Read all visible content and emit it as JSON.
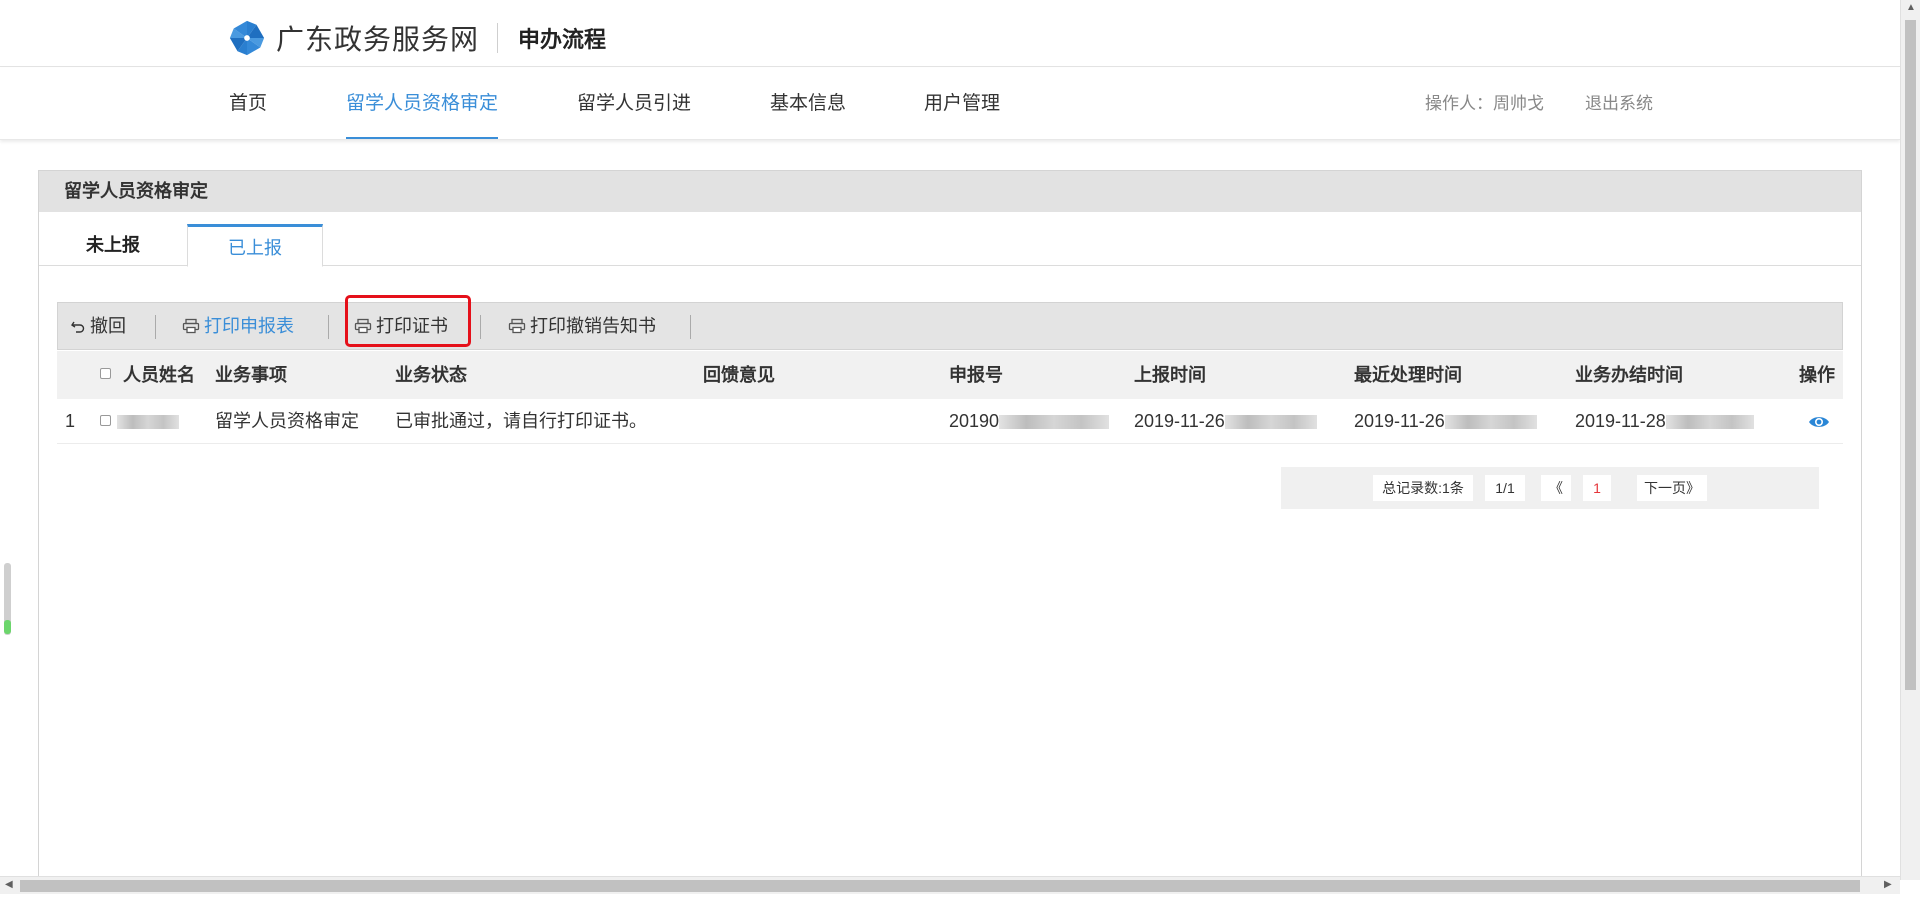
{
  "header": {
    "site_title": "广东政务服务网",
    "subtitle": "申办流程"
  },
  "nav": {
    "items": [
      {
        "label": "首页"
      },
      {
        "label": "留学人员资格审定"
      },
      {
        "label": "留学人员引进"
      },
      {
        "label": "基本信息"
      },
      {
        "label": "用户管理"
      }
    ],
    "active_index": 1,
    "operator": "操作人：周帅戈",
    "logout": "退出系统"
  },
  "panel": {
    "title": "留学人员资格审定",
    "tabs": [
      {
        "label": "未上报"
      },
      {
        "label": "已上报"
      }
    ],
    "active_tab": 1
  },
  "toolbar": {
    "withdraw": "撤回",
    "print_form": "打印申报表",
    "print_certificate": "打印证书",
    "print_cancel_notice": "打印撤销告知书"
  },
  "table": {
    "headers": {
      "name": "人员姓名",
      "item": "业务事项",
      "status": "业务状态",
      "feedback": "回馈意见",
      "report_no": "申报号",
      "report_time": "上报时间",
      "last_process_time": "最近处理时间",
      "finish_time": "业务办结时间",
      "action": "操作"
    },
    "rows": [
      {
        "index": "1",
        "item": "留学人员资格审定",
        "status": "已审批通过，请自行打印证书。",
        "feedback": "",
        "report_no": "20190",
        "report_time": "2019-11-26",
        "last_process_time": "2019-11-26",
        "finish_time": "2019-11-28"
      }
    ]
  },
  "pager": {
    "total": "总记录数:1条",
    "page_info": "1/1",
    "prev": "《",
    "current": "1",
    "next": "下一页》"
  },
  "colors": {
    "accent": "#3a8ed8",
    "highlight": "#e5101a"
  }
}
